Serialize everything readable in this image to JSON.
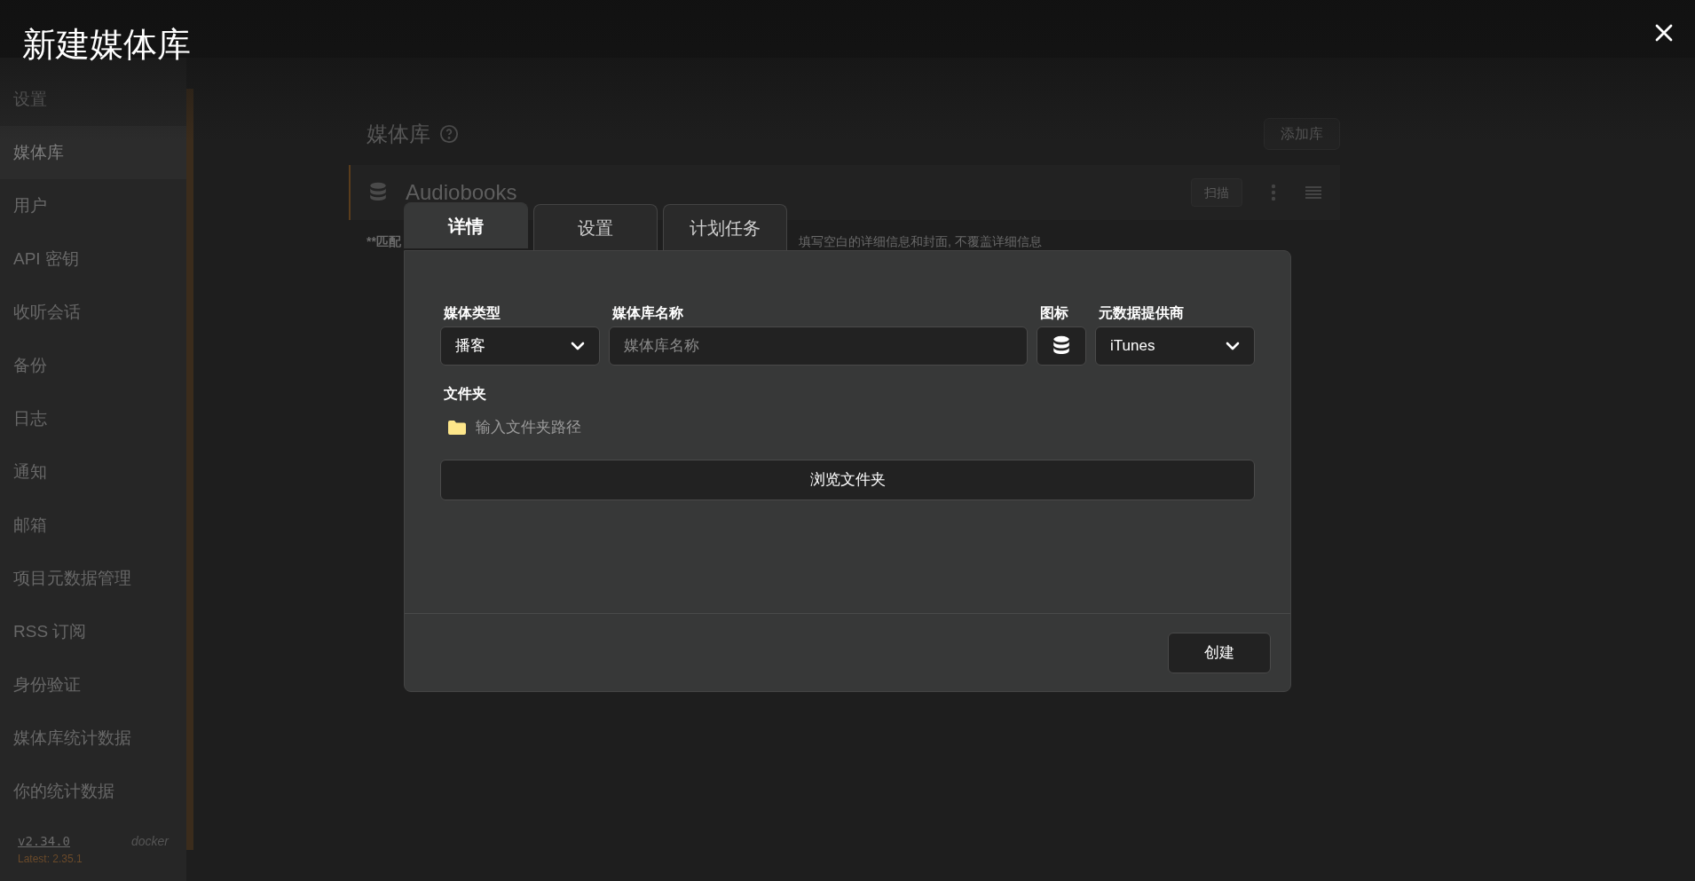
{
  "background": {
    "sidebar": {
      "heading": "设置",
      "items": [
        {
          "label": "媒体库",
          "selected": true
        },
        {
          "label": "用户",
          "selected": false
        },
        {
          "label": "API 密钥",
          "selected": false
        },
        {
          "label": "收听会话",
          "selected": false
        },
        {
          "label": "备份",
          "selected": false
        },
        {
          "label": "日志",
          "selected": false
        },
        {
          "label": "通知",
          "selected": false
        },
        {
          "label": "邮箱",
          "selected": false
        },
        {
          "label": "项目元数据管理",
          "selected": false
        },
        {
          "label": "RSS 订阅",
          "selected": false
        },
        {
          "label": "身份验证",
          "selected": false
        },
        {
          "label": "媒体库统计数据",
          "selected": false
        },
        {
          "label": "你的统计数据",
          "selected": false
        }
      ],
      "version": "v2.34.0",
      "build": "docker",
      "latest": "Latest: 2.35.1"
    },
    "page": {
      "title": "媒体库",
      "add_button": "添加库",
      "libraries": [
        {
          "name": "Audiobooks",
          "scan_button": "扫描"
        }
      ],
      "note_start": "**匹配",
      "note_end": "填写空白的详细信息和封面, 不覆盖详细信息"
    }
  },
  "dialog": {
    "title": "新建媒体库",
    "tabs": [
      {
        "label": "详情",
        "selected": true
      },
      {
        "label": "设置",
        "selected": false
      },
      {
        "label": "计划任务",
        "selected": false
      }
    ],
    "fields": [
      {
        "kind": "select",
        "label": "媒体类型",
        "value": "播客"
      },
      {
        "kind": "input",
        "label": "媒体库名称",
        "placeholder": "媒体库名称"
      },
      {
        "kind": "icon",
        "label": "图标"
      },
      {
        "kind": "select",
        "label": "元数据提供商",
        "value": "iTunes"
      }
    ],
    "folders": {
      "label": "文件夹",
      "placeholder": "输入文件夹路径"
    },
    "browse_button": "浏览文件夹",
    "create_button": "创建"
  }
}
